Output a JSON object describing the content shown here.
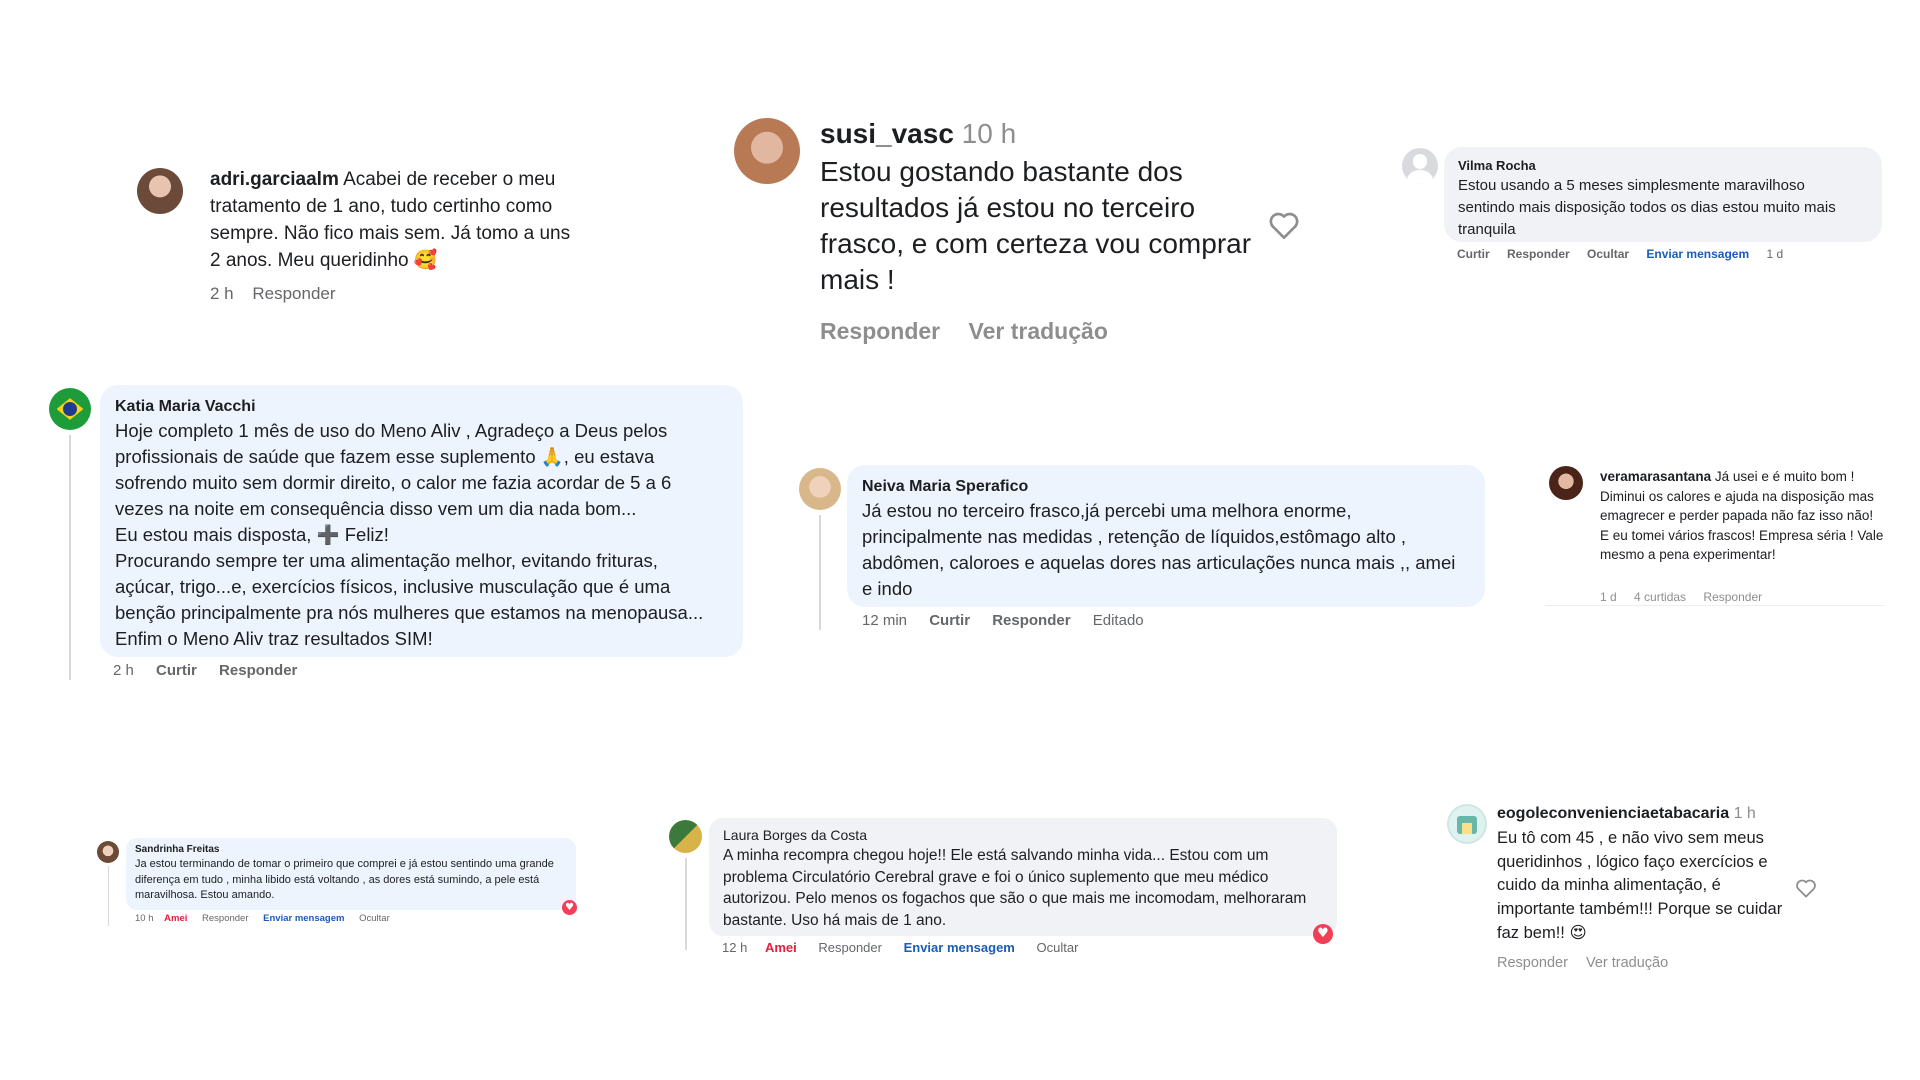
{
  "comments": {
    "adri": {
      "username": "adri.garciaalm",
      "text": "Acabei de receber o meu tratamento de 1 ano, tudo certinho como sempre. Não fico mais sem. Já tomo a uns 2 anos. Meu queridinho",
      "emoji": "🥰",
      "time": "2 h",
      "reply": "Responder"
    },
    "susi": {
      "username": "susi_vasc",
      "time": "10 h",
      "text": "Estou gostando bastante dos resultados já estou no terceiro frasco, e com certeza vou comprar mais !",
      "reply": "Responder",
      "translate": "Ver tradução",
      "icon": "heart-outline-icon"
    },
    "vilma": {
      "name": "Vilma Rocha",
      "text": "Estou usando a 5 meses simplesmente maravilhoso sentindo mais disposição todos os dias estou muito mais tranquila",
      "like": "Curtir",
      "reply": "Responder",
      "hide": "Ocultar",
      "message": "Enviar mensagem",
      "time": "1 d"
    },
    "katia": {
      "name": "Katia Maria Vacchi",
      "lines": [
        "Hoje completo 1 mês de uso do Meno Aliv , Agradeço a Deus pelos",
        "profissionais de saúde que fazem esse suplemento 🙏, eu estava",
        "sofrendo muito sem dormir direito, o calor me fazia acordar de 5 a 6",
        "vezes na noite em consequência disso vem um dia nada bom...",
        "Eu estou mais disposta, ➕ Feliz!",
        "Procurando sempre ter uma alimentação melhor, evitando frituras,",
        "açúcar, trigo...e, exercícios físicos, inclusive musculação que é uma",
        "benção principalmente pra nós mulheres que estamos na menopausa...",
        "Enfim o Meno Aliv traz resultados SIM!"
      ],
      "time": "2 h",
      "like": "Curtir",
      "reply": "Responder"
    },
    "neiva": {
      "name": "Neiva Maria Sperafico",
      "text": "Já estou no terceiro frasco,já percebi uma melhora enorme, principalmente nas medidas , retenção de líquidos,estômago alto , abdômen, caloroes e aquelas dores nas articulações nunca mais ,, amei e indo",
      "time": "12 min",
      "like": "Curtir",
      "reply": "Responder",
      "edited": "Editado"
    },
    "vera": {
      "username": "veramarasantana",
      "text": "Já usei e é muito bom ! Diminui os calores e ajuda na disposição mas emagrecer e perder papada não faz isso não! E eu tomei vários frascos! Empresa séria ! Vale mesmo a pena experimentar!",
      "time": "1 d",
      "likes": "4 curtidas",
      "reply": "Responder"
    },
    "sandrinha": {
      "name": "Sandrinha Freitas",
      "text": "Ja estou terminando de tomar o primeiro que comprei e já estou sentindo uma grande diferença em tudo , minha libido está voltando , as dores está sumindo, a pele está maravilhosa. Estou amando.",
      "time": "10 h",
      "loved": "Amei",
      "reply": "Responder",
      "message": "Enviar mensagem",
      "hide": "Ocultar",
      "reaction": "♥"
    },
    "laura": {
      "name": "Laura Borges da Costa",
      "text": "A minha recompra chegou hoje!! Ele está salvando minha vida... Estou com um problema Circulatório Cerebral grave e foi o único suplemento que meu médico autorizou. Pelo menos os fogachos que são o que mais me incomodam, melhoraram bastante. Uso há mais de 1 ano.",
      "time": "12 h",
      "loved": "Amei",
      "reply": "Responder",
      "message": "Enviar mensagem",
      "hide": "Ocultar",
      "reaction": "♥"
    },
    "eogole": {
      "username": "eogoleconvenienciaetabacaria",
      "time": "1 h",
      "text": "Eu tô com 45 , e não vivo sem meus queridinhos , lógico faço exercícios e cuido da minha alimentação, é importante também!!! Porque se cuidar faz bem!!",
      "emoji": "😍",
      "reply": "Responder",
      "translate": "Ver tradução",
      "icon": "heart-outline-icon"
    }
  },
  "colors": {
    "bubble_blue": "#eef4fd",
    "bubble_grey": "#f0f2f5",
    "meta_grey": "#65676b",
    "link_blue": "#1a5db8",
    "love_red": "#e41e3f"
  }
}
